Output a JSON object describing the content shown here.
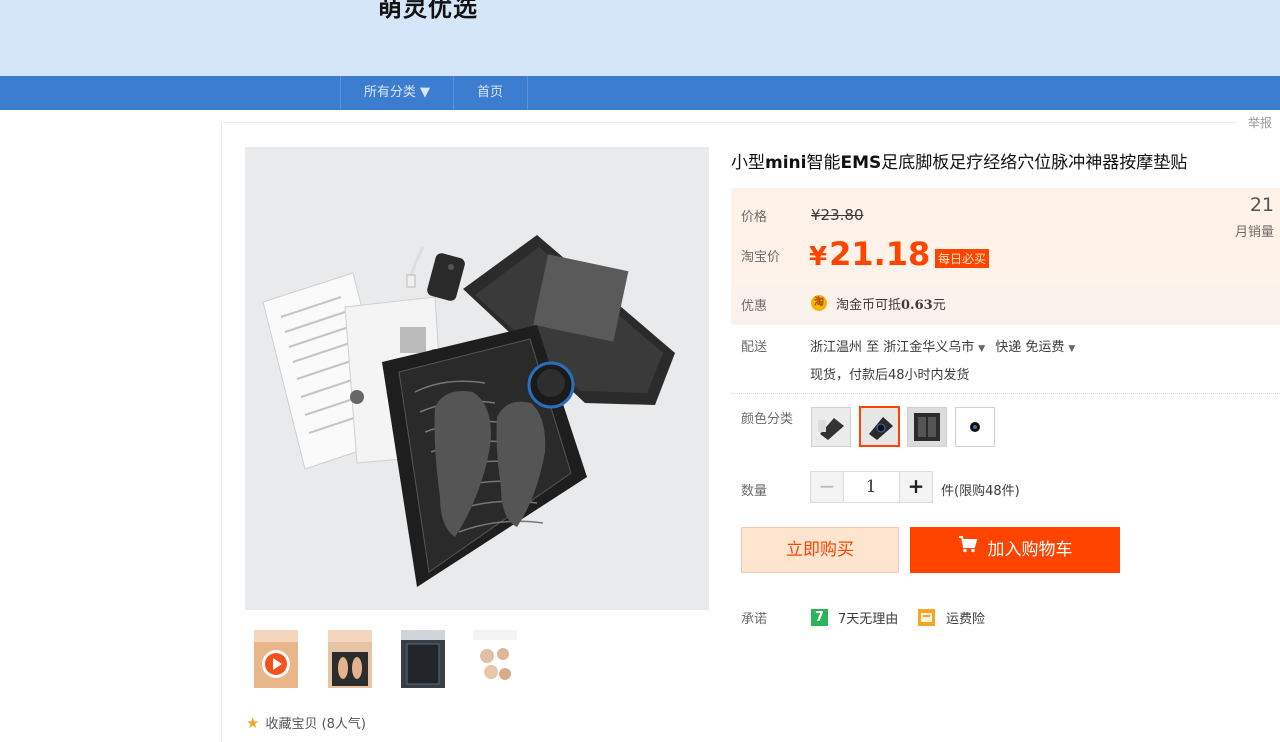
{
  "header": {
    "shop_name": "萌灵优选"
  },
  "nav": {
    "categories_label": "所有分类 ▼",
    "home_label": "首页"
  },
  "report_label": "举报",
  "product": {
    "title_prefix": "小型",
    "title_b1": "mini",
    "title_mid": "智能",
    "title_b2": "EMS",
    "title_rest": "足底脚板足疗经络穴位脉冲神器按摩垫贴"
  },
  "price": {
    "label": "价格",
    "original": "¥23.80",
    "tb_label": "淘宝价",
    "currency": "¥",
    "value": "21.18",
    "badge": "每日必买",
    "monthly_sales": "21",
    "monthly_sales_label": "月销量"
  },
  "offer": {
    "label": "优惠",
    "coin_icon_text": "淘",
    "text_prefix": "淘金币可抵",
    "amount": "0.63",
    "unit": "元"
  },
  "delivery": {
    "label": "配送",
    "from": "浙江温州 至",
    "to": "浙江金华义乌市",
    "method": "快递 免运费",
    "note": "现货，付款后48小时内发货"
  },
  "color": {
    "label": "颜色分类"
  },
  "quantity": {
    "label": "数量",
    "minus": "−",
    "value": "1",
    "plus": "+",
    "limit": "件(限购48件)"
  },
  "buttons": {
    "buy_now": "立即购买",
    "add_to_cart": "加入购物车"
  },
  "promise": {
    "label": "承诺",
    "seven_icon": "7",
    "seven_text": "7天无理由",
    "insurance_text": "运费险"
  },
  "favorite": {
    "text": "收藏宝贝 (8人气)"
  }
}
